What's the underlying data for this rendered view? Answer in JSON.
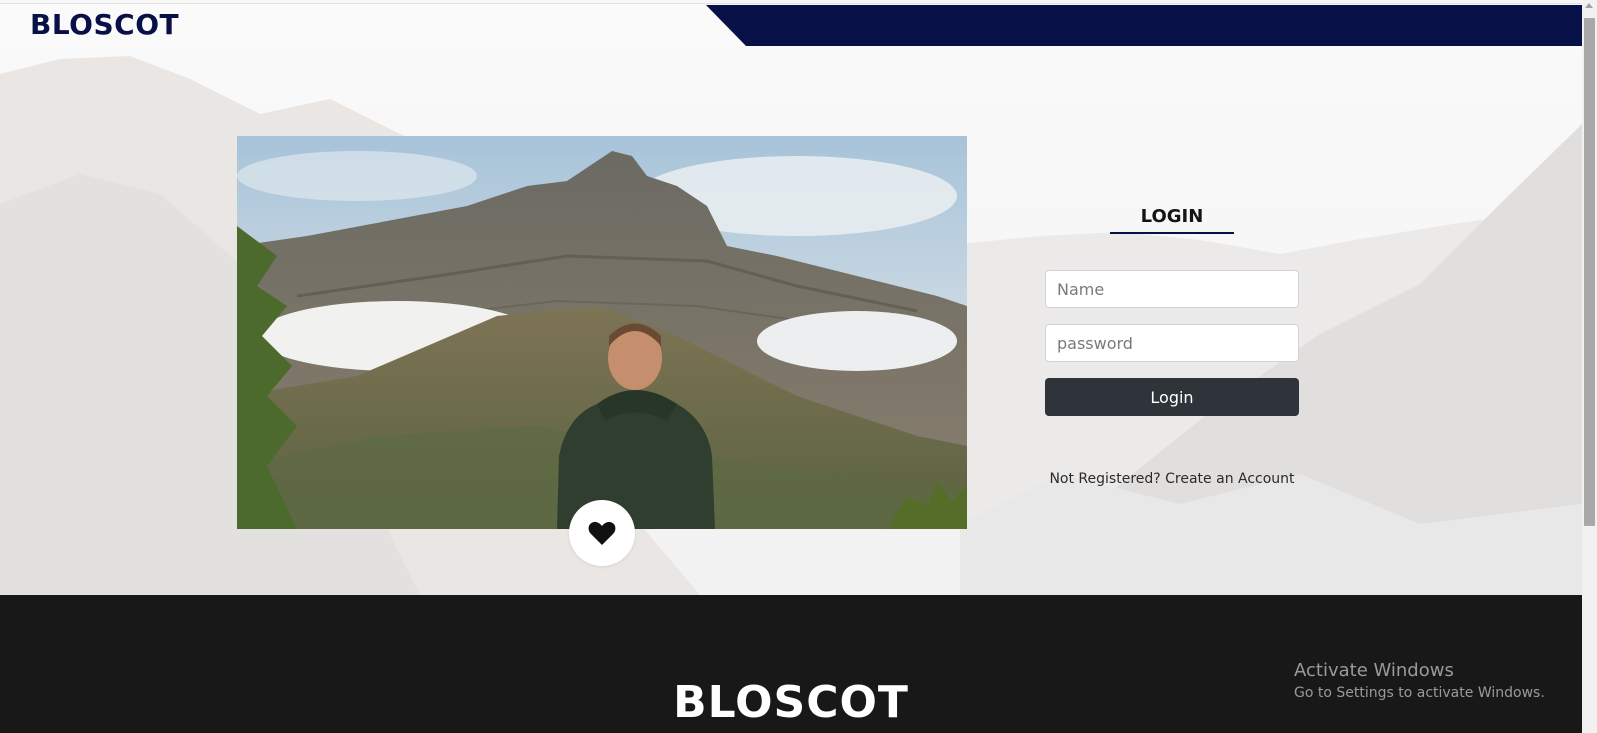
{
  "header": {
    "brand": "BLOSCOT",
    "accent_color": "#071047"
  },
  "hero": {
    "photo_alt": "man-facing-mountain-photo",
    "like_icon": "heart-icon"
  },
  "login": {
    "title": "LOGIN",
    "name_placeholder": "Name",
    "password_placeholder": "password",
    "button_label": "Login",
    "register_text": "Not Registered? Create an Account",
    "button_color": "#2e343a"
  },
  "footer": {
    "brand": "BLOSCOT",
    "background": "#181818"
  },
  "system": {
    "activate_title": "Activate Windows",
    "activate_subtitle": "Go to Settings to activate Windows."
  }
}
